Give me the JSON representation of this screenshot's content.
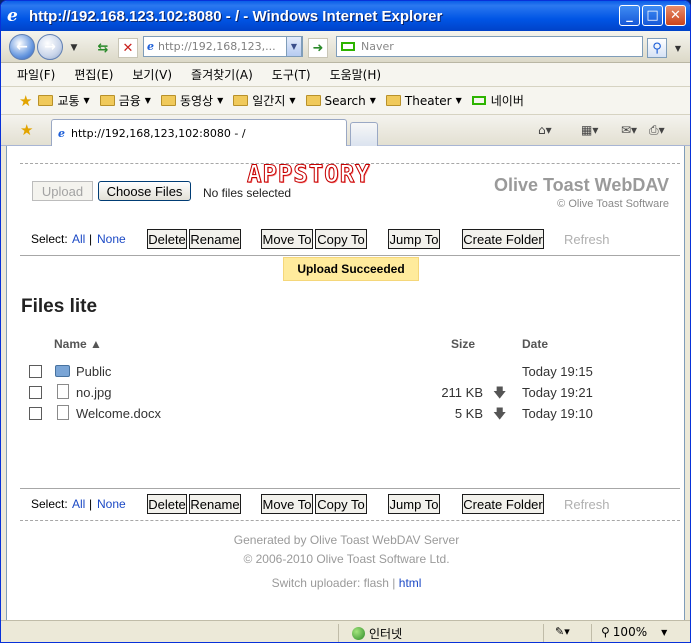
{
  "window": {
    "title": "http://192.168.123.102:8080 - / - Windows Internet Explorer",
    "controls": [
      "_",
      "□",
      "✕"
    ]
  },
  "nav": {
    "address": "http://192,168,123,...",
    "search_placeholder": "Naver"
  },
  "menu": [
    "파일(F)",
    "편집(E)",
    "보기(V)",
    "즐겨찾기(A)",
    "도구(T)",
    "도움말(H)"
  ],
  "favorites": [
    "교통",
    "금융",
    "동영상",
    "일간지",
    "Search",
    "Theater",
    "네이버"
  ],
  "tab": {
    "title": "http://192,168,123,102:8080 - /"
  },
  "page": {
    "upload_label": "Upload",
    "choose_files_label": "Choose Files",
    "no_files_text": "No files selected",
    "logo_text": "APPSTORY",
    "brand_title": "Olive Toast WebDAV",
    "brand_subtitle": "© Olive Toast Software",
    "select_label": "Select:",
    "select_all": "All",
    "select_separator": "|",
    "select_none": "None",
    "actions": {
      "delete": "Delete",
      "rename": "Rename",
      "move_to": "Move To",
      "copy_to": "Copy To",
      "jump_to": "Jump To",
      "create_folder": "Create Folder",
      "refresh": "Refresh"
    },
    "banner": "Upload Succeeded",
    "heading": "Files lite",
    "columns": {
      "name": "Name ▲",
      "size": "Size",
      "date": "Date"
    },
    "files": [
      {
        "name": "Public",
        "size": "",
        "date": "Today 19:15",
        "type": "folder"
      },
      {
        "name": "no.jpg",
        "size": "211 KB",
        "date": "Today 19:21",
        "type": "file"
      },
      {
        "name": "Welcome.docx",
        "size": "5 KB",
        "date": "Today 19:10",
        "type": "file"
      }
    ],
    "download_glyph": "🡇",
    "footer": {
      "generated": "Generated by Olive Toast WebDAV Server",
      "copyright": "© 2006-2010 Olive Toast Software Ltd.",
      "switch_label": "Switch uploader: flash |",
      "switch_link": "html"
    }
  },
  "status": {
    "zone": "인터넷",
    "zoom": "100%"
  }
}
